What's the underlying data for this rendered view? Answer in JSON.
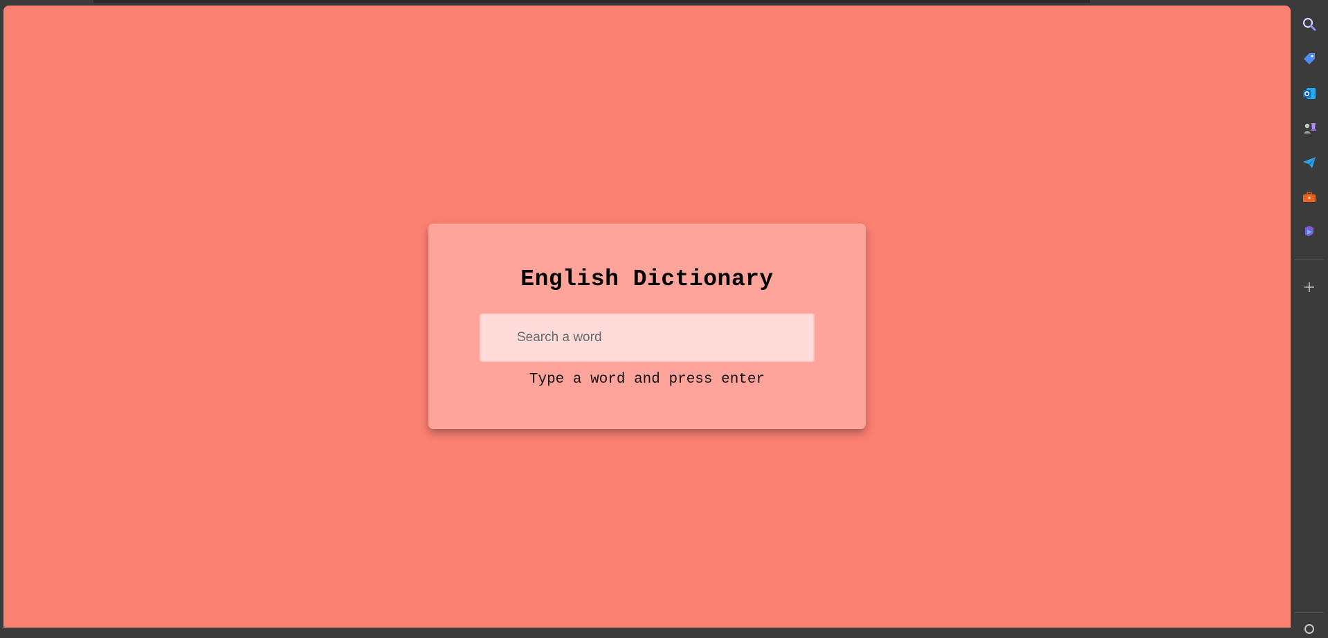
{
  "card": {
    "title": "English Dictionary",
    "search_placeholder": "Search a word",
    "search_value": "",
    "hint": "Type a word and press enter"
  },
  "colors": {
    "page_background": "#fa8072",
    "card_background": "#fea49b",
    "input_background": "#ffdcda",
    "browser_chrome": "#3b3b3b"
  },
  "sidebar": {
    "icons": [
      "search-icon",
      "shopping-tag-icon",
      "outlook-icon",
      "games-icon",
      "telegram-send-icon",
      "toolbox-icon",
      "copilot-icon",
      "add-icon",
      "settings-icon"
    ]
  }
}
